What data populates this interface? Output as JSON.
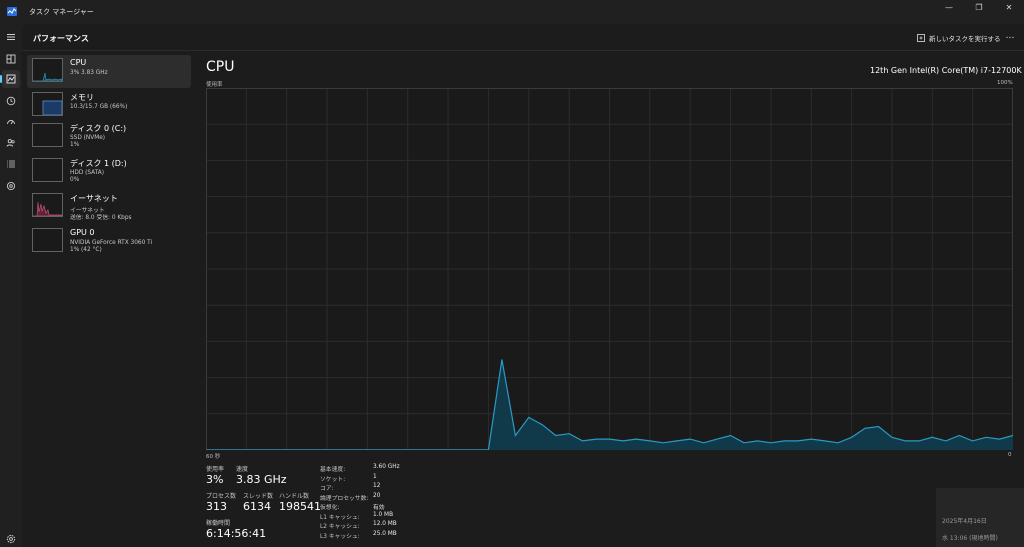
{
  "window": {
    "title": "タスク マネージャー",
    "minimize_glyph": "—",
    "maximize_glyph": "❐",
    "close_glyph": "✕"
  },
  "nav": {
    "items": [
      "hamburger-icon",
      "processes-icon",
      "performance-icon",
      "app-history-icon",
      "startup-apps-icon",
      "users-icon",
      "details-icon",
      "services-icon"
    ],
    "settings": "settings-icon"
  },
  "header": {
    "title": "パフォーマンス",
    "run_task_label": "新しいタスクを実行する",
    "more_label": "…"
  },
  "devices": [
    {
      "name": "CPU",
      "line1": "3%  3.83 GHz",
      "line2": "",
      "active": true
    },
    {
      "name": "メモリ",
      "line1": "10.3/15.7 GB (66%)",
      "line2": "",
      "active": false
    },
    {
      "name": "ディスク 0 (C:)",
      "line1": "SSD (NVMe)",
      "line2": "1%",
      "active": false
    },
    {
      "name": "ディスク 1 (D:)",
      "line1": "HDD (SATA)",
      "line2": "0%",
      "active": false
    },
    {
      "name": "イーサネット",
      "line1": "イーサネット",
      "line2": "送信: 8.0 受信: 0 Kbps",
      "active": false
    },
    {
      "name": "GPU 0",
      "line1": "NVIDIA GeForce RTX 3060 Ti",
      "line2": "1% (42 °C)",
      "active": false
    }
  ],
  "cpu": {
    "title": "CPU",
    "model": "12th Gen Intel(R) Core(TM) i7-12700K",
    "graph_top_left": "使用率",
    "graph_top_right": "100%",
    "graph_bottom_left": "60 秒",
    "graph_bottom_right": "0"
  },
  "chart_data": {
    "type": "area",
    "x": [
      0,
      1,
      2,
      3,
      4,
      5,
      6,
      7,
      8,
      9,
      10,
      11,
      12,
      13,
      14,
      15,
      16,
      17,
      18,
      19,
      20,
      21,
      22,
      23,
      24,
      25,
      26,
      27,
      28,
      29,
      30,
      31,
      32,
      33,
      34,
      35,
      36,
      37,
      38,
      39,
      40,
      41,
      42,
      43,
      44,
      45,
      46,
      47,
      48,
      49,
      50,
      51,
      52,
      53,
      54,
      55,
      56,
      57,
      58,
      59,
      60
    ],
    "values": [
      0,
      0,
      0,
      0,
      0,
      0,
      0,
      0,
      0,
      0,
      0,
      0,
      0,
      0,
      0,
      0,
      0,
      0,
      0,
      0,
      0,
      0,
      25,
      4,
      9,
      7,
      4,
      4.5,
      2.5,
      3,
      3,
      2.5,
      3,
      2.5,
      2,
      2.5,
      3,
      2,
      3,
      4,
      2,
      2.5,
      2,
      2.5,
      2.5,
      3,
      2.5,
      2,
      3.5,
      6,
      6.5,
      3.5,
      2.5,
      2.5,
      3.5,
      2.5,
      4,
      2.5,
      3.5,
      3,
      4
    ],
    "xlim": [
      0,
      60
    ],
    "ylim": [
      0,
      100
    ],
    "grid": true,
    "line_color": "#2b99c4",
    "fill_color": "#103a4a",
    "background": "#1a1a1a",
    "grid_color": "#2c2c2c"
  },
  "stats": {
    "usage_label": "使用率",
    "usage_value": "3%",
    "speed_label": "速度",
    "speed_value": "3.83 GHz",
    "processes_label": "プロセス数",
    "processes_value": "313",
    "threads_label": "スレッド数",
    "threads_value": "6134",
    "handles_label": "ハンドル数",
    "handles_value": "198541",
    "uptime_label": "稼働時間",
    "uptime_value": "6:14:56:41"
  },
  "specs": [
    {
      "label": "基本速度:",
      "value": "3.60 GHz"
    },
    {
      "label": "ソケット:",
      "value": "1"
    },
    {
      "label": "コア:",
      "value": "12"
    },
    {
      "label": "論理プロセッサ数:",
      "value": "20"
    },
    {
      "label": "仮想化:",
      "value": "有効"
    },
    {
      "label": "L1 キャッシュ:",
      "value": "1.0 MB"
    },
    {
      "label": "L2 キャッシュ:",
      "value": "12.0 MB"
    },
    {
      "label": "L3 キャッシュ:",
      "value": "25.0 MB"
    }
  ],
  "taskbar": {
    "date": "2025年4月16日",
    "time": "水 13:06 (現地時間)"
  },
  "colors": {
    "accent": "#60cdff",
    "cpu_graph": "#2b99c4",
    "memory_graph": "#5b8fd9",
    "ethernet_graph": "#c2517b"
  }
}
